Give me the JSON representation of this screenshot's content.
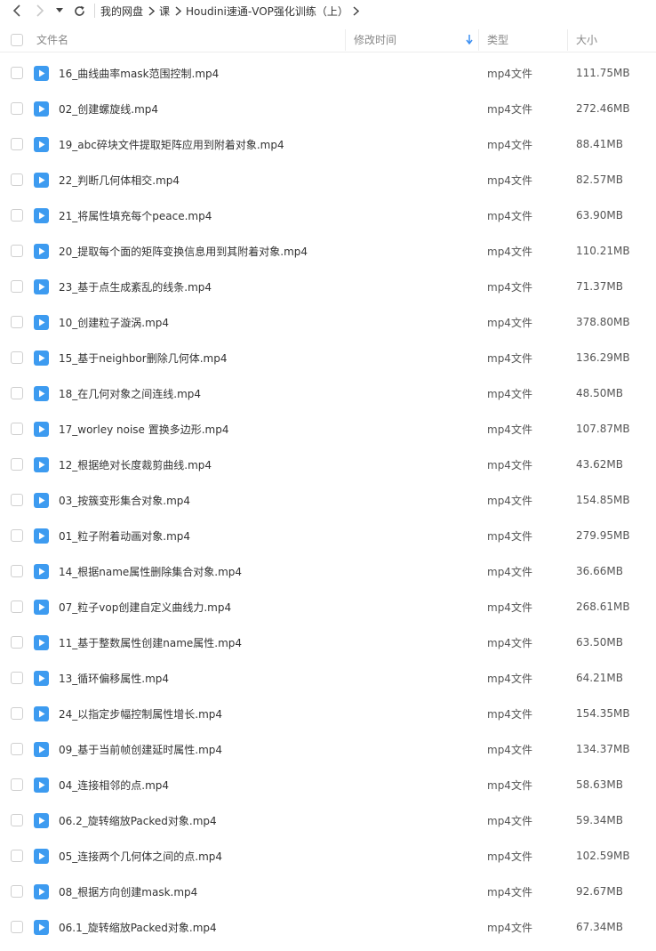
{
  "breadcrumb": [
    "我的网盘",
    "课",
    "Houdini速通-VOP强化训练（上）"
  ],
  "columns": {
    "name": "文件名",
    "modified": "修改时间",
    "type": "类型",
    "size": "大小"
  },
  "colors": {
    "accent": "#3b8ff2",
    "file_icon": "#3d9bf0"
  },
  "files": [
    {
      "name": "16_曲线曲率mask范围控制.mp4",
      "type": "mp4文件",
      "size": "111.75MB"
    },
    {
      "name": "02_创建螺旋线.mp4",
      "type": "mp4文件",
      "size": "272.46MB"
    },
    {
      "name": "19_abc碎块文件提取矩阵应用到附着对象.mp4",
      "type": "mp4文件",
      "size": "88.41MB"
    },
    {
      "name": "22_判断几何体相交.mp4",
      "type": "mp4文件",
      "size": "82.57MB"
    },
    {
      "name": "21_将属性填充每个peace.mp4",
      "type": "mp4文件",
      "size": "63.90MB"
    },
    {
      "name": "20_提取每个面的矩阵变换信息用到其附着对象.mp4",
      "type": "mp4文件",
      "size": "110.21MB"
    },
    {
      "name": "23_基于点生成紊乱的线条.mp4",
      "type": "mp4文件",
      "size": "71.37MB"
    },
    {
      "name": "10_创建粒子漩涡.mp4",
      "type": "mp4文件",
      "size": "378.80MB"
    },
    {
      "name": "15_基于neighbor删除几何体.mp4",
      "type": "mp4文件",
      "size": "136.29MB"
    },
    {
      "name": "18_在几何对象之间连线.mp4",
      "type": "mp4文件",
      "size": "48.50MB"
    },
    {
      "name": "17_worley noise 置换多边形.mp4",
      "type": "mp4文件",
      "size": "107.87MB"
    },
    {
      "name": "12_根据绝对长度裁剪曲线.mp4",
      "type": "mp4文件",
      "size": "43.62MB"
    },
    {
      "name": "03_按簇变形集合对象.mp4",
      "type": "mp4文件",
      "size": "154.85MB"
    },
    {
      "name": "01_粒子附着动画对象.mp4",
      "type": "mp4文件",
      "size": "279.95MB"
    },
    {
      "name": "14_根据name属性删除集合对象.mp4",
      "type": "mp4文件",
      "size": "36.66MB"
    },
    {
      "name": "07_粒子vop创建自定义曲线力.mp4",
      "type": "mp4文件",
      "size": "268.61MB"
    },
    {
      "name": "11_基于整数属性创建name属性.mp4",
      "type": "mp4文件",
      "size": "63.50MB"
    },
    {
      "name": "13_循环偏移属性.mp4",
      "type": "mp4文件",
      "size": "64.21MB"
    },
    {
      "name": "24_以指定步幅控制属性增长.mp4",
      "type": "mp4文件",
      "size": "154.35MB"
    },
    {
      "name": "09_基于当前帧创建延时属性.mp4",
      "type": "mp4文件",
      "size": "134.37MB"
    },
    {
      "name": "04_连接相邻的点.mp4",
      "type": "mp4文件",
      "size": "58.63MB"
    },
    {
      "name": "06.2_旋转缩放Packed对象.mp4",
      "type": "mp4文件",
      "size": "59.34MB"
    },
    {
      "name": "05_连接两个几何体之间的点.mp4",
      "type": "mp4文件",
      "size": "102.59MB"
    },
    {
      "name": "08_根据方向创建mask.mp4",
      "type": "mp4文件",
      "size": "92.67MB"
    },
    {
      "name": "06.1_旋转缩放Packed对象.mp4",
      "type": "mp4文件",
      "size": "67.34MB"
    }
  ]
}
